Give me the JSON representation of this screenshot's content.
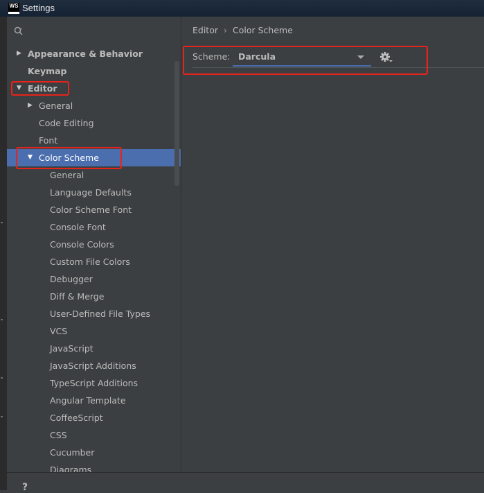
{
  "window": {
    "title": "Settings",
    "app_logo": "WS"
  },
  "search": {
    "icon": "search-icon",
    "placeholder": ""
  },
  "sidebar": {
    "items": [
      {
        "label": "Appearance & Behavior",
        "level": 0,
        "expander": "collapsed",
        "bold": true,
        "selected": false
      },
      {
        "label": "Keymap",
        "level": 0,
        "expander": "none",
        "bold": true,
        "selected": false
      },
      {
        "label": "Editor",
        "level": 0,
        "expander": "expanded",
        "bold": true,
        "selected": false
      },
      {
        "label": "General",
        "level": 1,
        "expander": "collapsed",
        "bold": false,
        "selected": false
      },
      {
        "label": "Code Editing",
        "level": 1,
        "expander": "none",
        "bold": false,
        "selected": false
      },
      {
        "label": "Font",
        "level": 1,
        "expander": "none",
        "bold": false,
        "selected": false
      },
      {
        "label": "Color Scheme",
        "level": 1,
        "expander": "expanded",
        "bold": false,
        "selected": true
      },
      {
        "label": "General",
        "level": 2,
        "expander": "none",
        "bold": false,
        "selected": false
      },
      {
        "label": "Language Defaults",
        "level": 2,
        "expander": "none",
        "bold": false,
        "selected": false
      },
      {
        "label": "Color Scheme Font",
        "level": 2,
        "expander": "none",
        "bold": false,
        "selected": false
      },
      {
        "label": "Console Font",
        "level": 2,
        "expander": "none",
        "bold": false,
        "selected": false
      },
      {
        "label": "Console Colors",
        "level": 2,
        "expander": "none",
        "bold": false,
        "selected": false
      },
      {
        "label": "Custom File Colors",
        "level": 2,
        "expander": "none",
        "bold": false,
        "selected": false
      },
      {
        "label": "Debugger",
        "level": 2,
        "expander": "none",
        "bold": false,
        "selected": false
      },
      {
        "label": "Diff & Merge",
        "level": 2,
        "expander": "none",
        "bold": false,
        "selected": false
      },
      {
        "label": "User-Defined File Types",
        "level": 2,
        "expander": "none",
        "bold": false,
        "selected": false
      },
      {
        "label": "VCS",
        "level": 2,
        "expander": "none",
        "bold": false,
        "selected": false
      },
      {
        "label": "JavaScript",
        "level": 2,
        "expander": "none",
        "bold": false,
        "selected": false
      },
      {
        "label": "JavaScript Additions",
        "level": 2,
        "expander": "none",
        "bold": false,
        "selected": false
      },
      {
        "label": "TypeScript Additions",
        "level": 2,
        "expander": "none",
        "bold": false,
        "selected": false
      },
      {
        "label": "Angular Template",
        "level": 2,
        "expander": "none",
        "bold": false,
        "selected": false
      },
      {
        "label": "CoffeeScript",
        "level": 2,
        "expander": "none",
        "bold": false,
        "selected": false
      },
      {
        "label": "CSS",
        "level": 2,
        "expander": "none",
        "bold": false,
        "selected": false
      },
      {
        "label": "Cucumber",
        "level": 2,
        "expander": "none",
        "bold": false,
        "selected": false
      },
      {
        "label": "Diagrams",
        "level": 2,
        "expander": "none",
        "bold": false,
        "selected": false
      }
    ]
  },
  "breadcrumb": {
    "parent": "Editor",
    "separator": "›",
    "current": "Color Scheme"
  },
  "scheme": {
    "label": "Scheme:",
    "value": "Darcula",
    "dropdown_icon": "caret-down-icon",
    "settings_icon": "gear-icon"
  },
  "footer": {
    "help": "?"
  },
  "colors": {
    "background": "#3c3f41",
    "selection": "#4b6eaf",
    "text": "#bbbbbb",
    "annotation": "#e8231c"
  }
}
